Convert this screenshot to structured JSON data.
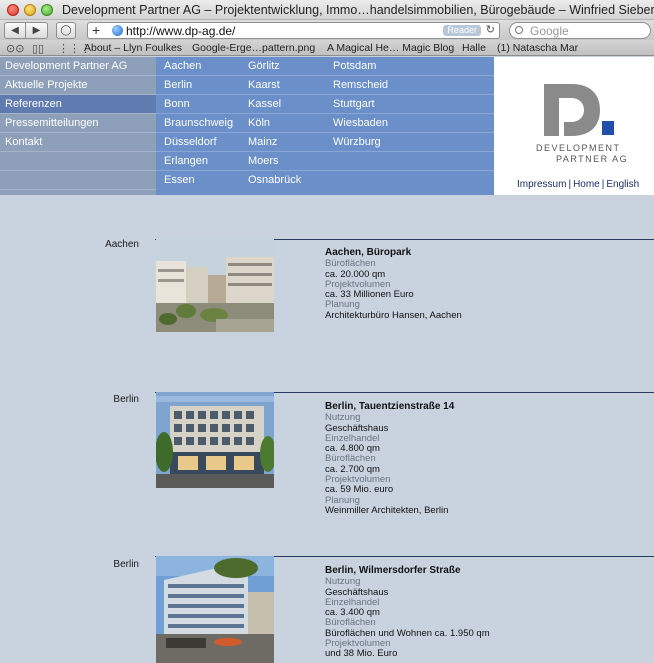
{
  "window": {
    "title": "Development Partner AG – Projektentwicklung, Immo…handelsimmobilien, Bürogebäude – Winfried Siebers"
  },
  "toolbar": {
    "url": "http://www.dp-ag.de/",
    "reader_label": "Reader",
    "search_placeholder": "Google"
  },
  "bookmarks": [
    "About – Llyn Foulkes",
    "Google-Erge…pattern.png",
    "A Magical He… Magic Blog",
    "Halle",
    "(1) Natascha Mar"
  ],
  "site_nav": [
    {
      "label": "Development Partner AG",
      "active": false
    },
    {
      "label": "Aktuelle Projekte",
      "active": false
    },
    {
      "label": "Referenzen",
      "active": true
    },
    {
      "label": "Pressemitteilungen",
      "active": false
    },
    {
      "label": "Kontakt",
      "active": false
    }
  ],
  "cities": [
    [
      "Aachen",
      "Görlitz",
      "Potsdam"
    ],
    [
      "Berlin",
      "Kaarst",
      "Remscheid"
    ],
    [
      "Bonn",
      "Kassel",
      "Stuttgart"
    ],
    [
      "Braunschweig",
      "Köln",
      "Wiesbaden"
    ],
    [
      "Düsseldorf",
      "Mainz",
      "Würzburg"
    ],
    [
      "Erlangen",
      "Moers",
      ""
    ],
    [
      "Essen",
      "Osnabrück",
      ""
    ]
  ],
  "logo": {
    "line1": "DEVELOPMENT",
    "line2": "PARTNER AG",
    "colors": {
      "gray": "#8a8a8a",
      "blue": "#1f4fa8"
    }
  },
  "footer_links": [
    "Impressum",
    "Home",
    "English"
  ],
  "entries": [
    {
      "city": "Aachen",
      "title": "Aachen, Büropark",
      "lines": [
        {
          "t": "Büroflächen",
          "lab": true
        },
        {
          "t": "ca. 20.000 qm",
          "lab": false
        },
        {
          "t": "Projektvolumen",
          "lab": true
        },
        {
          "t": "ca. 33 Millionen Euro",
          "lab": false
        },
        {
          "t": "Planung",
          "lab": true
        },
        {
          "t": "Architekturbüro Hansen, Aachen",
          "lab": false
        }
      ]
    },
    {
      "city": "Berlin",
      "title": "Berlin, Tauentzienstraße 14",
      "lines": [
        {
          "t": "Nutzung",
          "lab": true
        },
        {
          "t": "Geschäftshaus",
          "lab": false
        },
        {
          "t": "Einzelhandel",
          "lab": true
        },
        {
          "t": "ca. 4.800 qm",
          "lab": false
        },
        {
          "t": "Büroflächen",
          "lab": true
        },
        {
          "t": "ca. 2.700 qm",
          "lab": false
        },
        {
          "t": "Projektvolumen",
          "lab": true
        },
        {
          "t": "ca. 59 Mio. euro",
          "lab": false
        },
        {
          "t": "Planung",
          "lab": true
        },
        {
          "t": "Weinmiller Architekten, Berlin",
          "lab": false
        }
      ]
    },
    {
      "city": "Berlin",
      "title": "Berlin, Wilmersdorfer Straße",
      "lines": [
        {
          "t": "Nutzung",
          "lab": true
        },
        {
          "t": "Geschäftshaus",
          "lab": false
        },
        {
          "t": "Einzelhandel",
          "lab": true
        },
        {
          "t": "ca. 3.400 qm",
          "lab": false
        },
        {
          "t": "Büroflächen",
          "lab": true
        },
        {
          "t": "Büroflächen und Wohnen ca. 1.950 qm",
          "lab": false
        },
        {
          "t": "Projektvolumen",
          "lab": true
        },
        {
          "t": "und 38 Mio. Euro",
          "lab": false
        }
      ]
    }
  ]
}
